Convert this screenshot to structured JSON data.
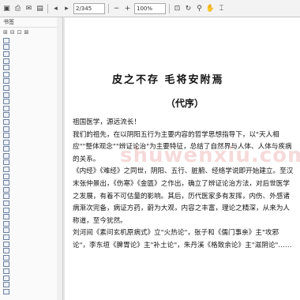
{
  "toolbar": {
    "page_field": "2/345",
    "zoom_field": "100%",
    "extra_field": ""
  },
  "sidebar": {
    "header": "书签",
    "tools": [
      "⊞",
      "⊟",
      "⊡",
      "⊠"
    ],
    "items": [
      "",
      "",
      "",
      "",
      "",
      "",
      "",
      "",
      "",
      "",
      "",
      "",
      "",
      "",
      "",
      "",
      "",
      "",
      "",
      "",
      "",
      "",
      "",
      "",
      "",
      "",
      "",
      "",
      "",
      "",
      "",
      "",
      "",
      "",
      "",
      "",
      "",
      ""
    ]
  },
  "document": {
    "title": "皮之不存  毛将安附焉",
    "subtitle": "（代序）",
    "paragraphs": [
      "祖国医学，源远流长！",
      "我们的祖先，在以阴阳五行为主要内容的哲学思想指导下，以\"天人相应\"\"整体观念\"\"辨证论治\"为主要特征，总结了自然界与人体、人体与疾病的关系。",
      "《内经》《难经》之同世，阴阳、五行、脏腑、经络学说即开始建立。至汉末张仲景出，《伤寒》《金匮》之作出，确立了辨证论治方法，对后世医学之发展，有着不可估量的影响。其后，历代医家多有发挥，内伤、外感诸病渐次完备，病证方药，蔚为大观，内容之丰富，理论之精深，从来为人称道，至今犹然。",
      "刘河间《素问玄机原病式》立\"火热论\"，张子和《儒门事亲》主\"攻邪论\"，李东垣《脾胃论》主\"补土论\"，朱丹溪《格致余论》主\"滋阴论\"……"
    ]
  },
  "watermark": "shuwenxiu.com"
}
